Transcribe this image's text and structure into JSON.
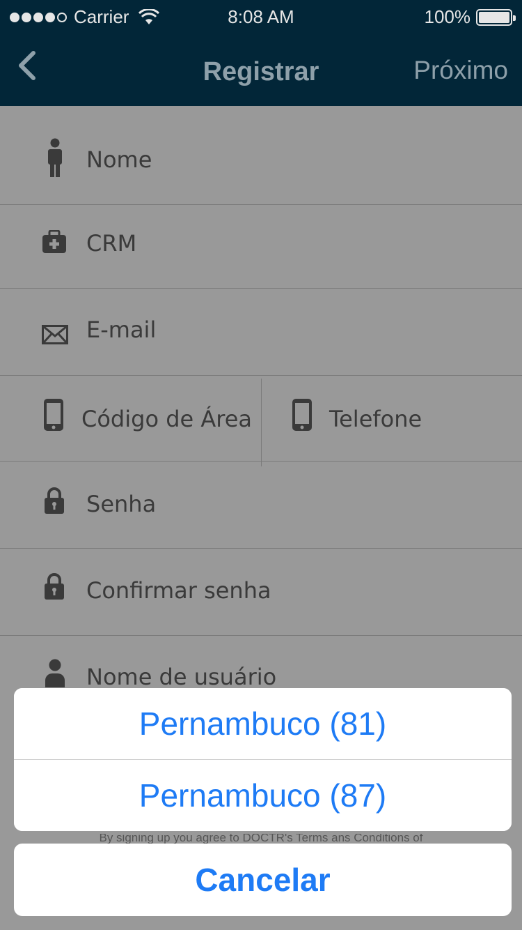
{
  "status_bar": {
    "carrier": "Carrier",
    "time": "8:08 AM",
    "battery": "100%"
  },
  "nav": {
    "title": "Registrar",
    "next_label": "Próximo",
    "back_icon": "chevron-left-icon"
  },
  "form": {
    "name_placeholder": "Nome",
    "crm_placeholder": "CRM",
    "email_placeholder": "E-mail",
    "area_code_placeholder": "Código de Área",
    "phone_placeholder": "Telefone",
    "password_placeholder": "Senha",
    "confirm_password_placeholder": "Confirmar senha",
    "username_placeholder": "Nome de usuário"
  },
  "terms_text": "By signing up you agree to DOCTR's Terms ans Conditions of",
  "action_sheet": {
    "options": [
      "Pernambuco (81)",
      "Pernambuco (87)"
    ],
    "cancel_label": "Cancelar"
  },
  "colors": {
    "nav_bg": "#022638",
    "form_bg": "#999999",
    "accent": "#1e7bf5"
  }
}
